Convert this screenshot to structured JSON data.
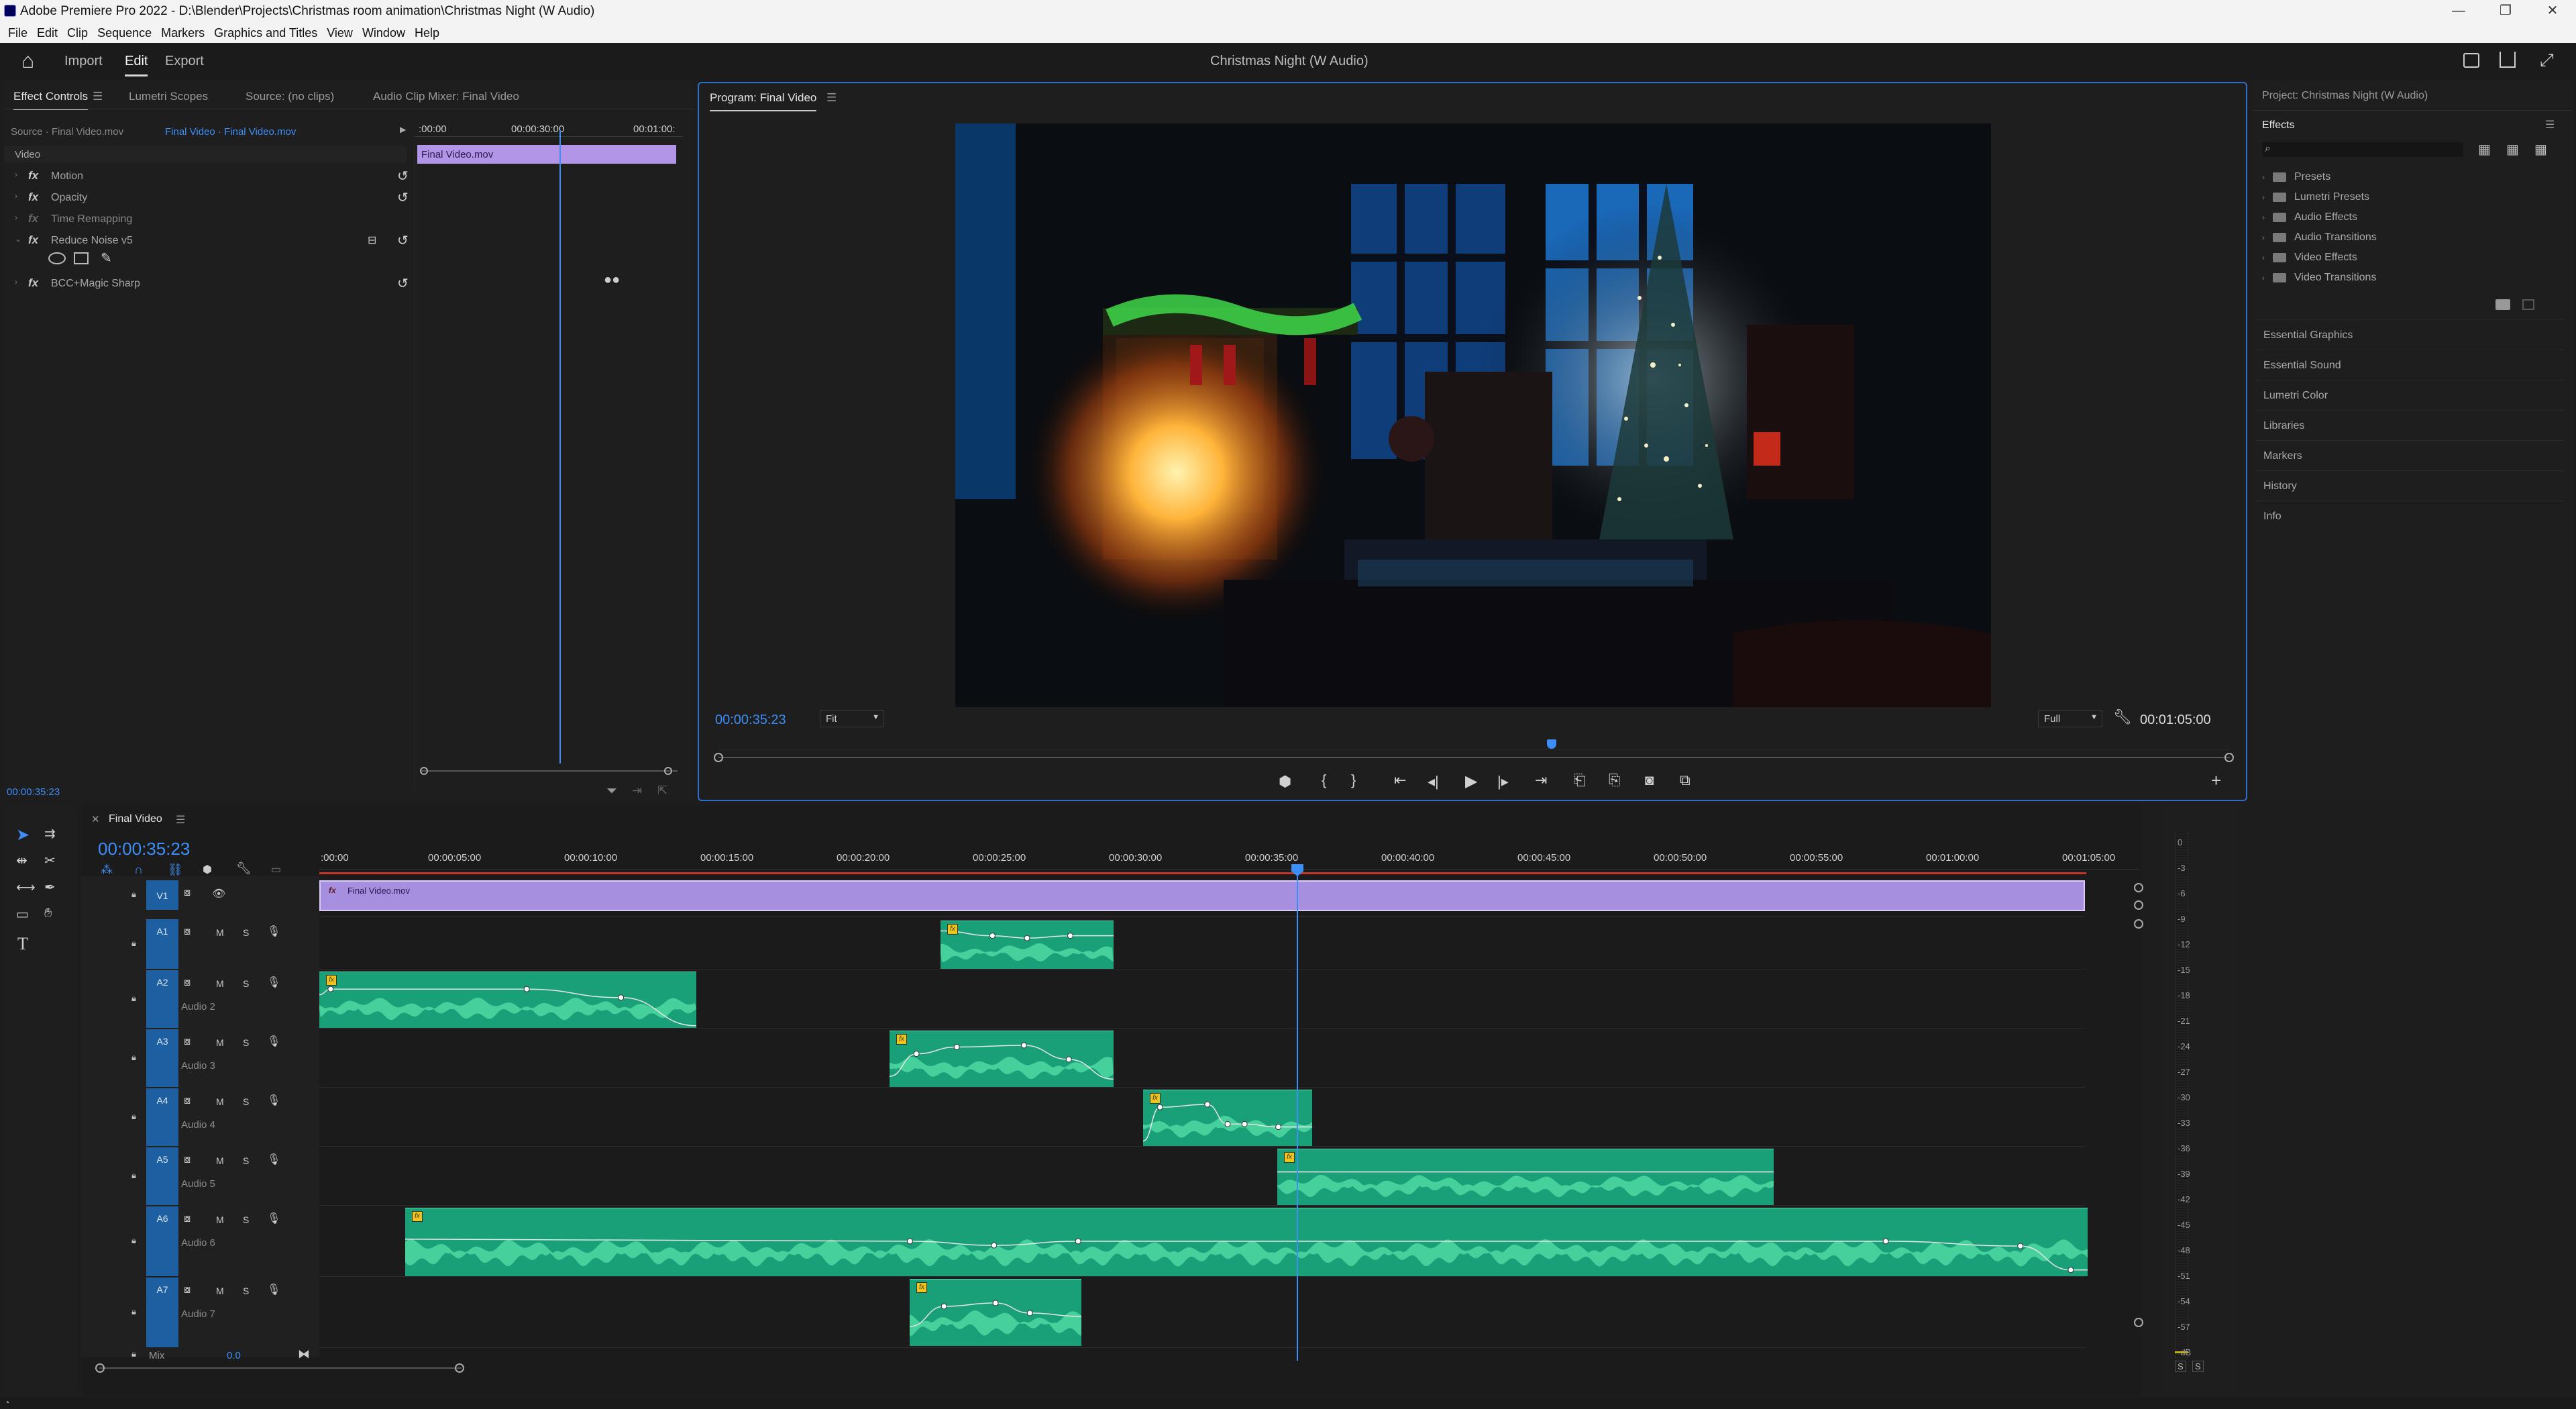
{
  "titlebar": {
    "title": "Adobe Premiere Pro 2022 - D:\\Blender\\Projects\\Christmas room animation\\Christmas Night (W Audio)",
    "minimize": "—",
    "restore": "❐",
    "close": "✕"
  },
  "menu": [
    "File",
    "Edit",
    "Clip",
    "Sequence",
    "Markers",
    "Graphics and Titles",
    "View",
    "Window",
    "Help"
  ],
  "header": {
    "home": "⌂",
    "workspaces": [
      "Import",
      "Edit",
      "Export"
    ],
    "active": "Edit",
    "project_title": "Christmas Night (W Audio)"
  },
  "effect_controls": {
    "tabs": [
      "Effect Controls",
      "Lumetri Scopes",
      "Source: (no clips)",
      "Audio Clip Mixer: Final Video"
    ],
    "source_label": "Source · Final Video.mov",
    "sequence_label": "Final Video · Final Video.mov",
    "mini_ruler": [
      ":00:00",
      "00:00:30:00",
      "00:01:00:"
    ],
    "clip_label": "Final Video.mov",
    "section": "Video",
    "effects": [
      "Motion",
      "Opacity",
      "Time Remapping",
      "Reduce Noise v5",
      "BCC+Magic Sharp"
    ],
    "timecode": "00:00:35:23"
  },
  "program": {
    "tab": "Program: Final Video",
    "timecode": "00:00:35:23",
    "fit": "Fit",
    "quality": "Full",
    "duration": "00:01:05:00",
    "controls": [
      "marker",
      "in",
      "out",
      "go-in",
      "step-back",
      "play",
      "step-forward",
      "go-out",
      "lift",
      "extract",
      "export-frame",
      "compare"
    ]
  },
  "project": {
    "title": "Project: Christmas Night (W Audio)",
    "effects_tab": "Effects",
    "tree": [
      "Presets",
      "Lumetri Presets",
      "Audio Effects",
      "Audio Transitions",
      "Video Effects",
      "Video Transitions"
    ],
    "sections": [
      "Essential Graphics",
      "Essential Sound",
      "Lumetri Color",
      "Libraries",
      "Markers",
      "History",
      "Info"
    ]
  },
  "timeline": {
    "tab": "Final Video",
    "timecode": "00:00:35:23",
    "ruler": [
      ":00:00",
      "00:00:05:00",
      "00:00:10:00",
      "00:00:15:00",
      "00:00:20:00",
      "00:00:25:00",
      "00:00:30:00",
      "00:00:35:00",
      "00:00:40:00",
      "00:00:45:00",
      "00:00:50:00",
      "00:00:55:00",
      "00:01:00:00",
      "00:01:05:00"
    ],
    "video_clip": "Final Video.mov",
    "tracks": [
      {
        "id": "V1",
        "name": ""
      },
      {
        "id": "A1",
        "name": ""
      },
      {
        "id": "A2",
        "name": "Audio 2"
      },
      {
        "id": "A3",
        "name": "Audio 3"
      },
      {
        "id": "A4",
        "name": "Audio 4"
      },
      {
        "id": "A5",
        "name": "Audio 5"
      },
      {
        "id": "A6",
        "name": "Audio 6"
      },
      {
        "id": "A7",
        "name": "Audio 7"
      }
    ],
    "mix_label": "Mix",
    "mix_value": "0.0",
    "track_buttons": {
      "mute": "M",
      "solo": "S"
    }
  },
  "meter": {
    "labels": [
      "0",
      "-3",
      "-6",
      "-9",
      "-12",
      "-15",
      "-18",
      "-21",
      "-24",
      "-27",
      "-30",
      "-33",
      "-36",
      "-39",
      "-42",
      "-45",
      "-48",
      "-51",
      "-54",
      "-57",
      "-dB"
    ],
    "solo": [
      "S",
      "S"
    ]
  },
  "colors": {
    "accent": "#3e8ef7",
    "video_clip": "#a78fe0",
    "audio_clip": "#1aa079",
    "track_badge": "#1d5fa0"
  }
}
